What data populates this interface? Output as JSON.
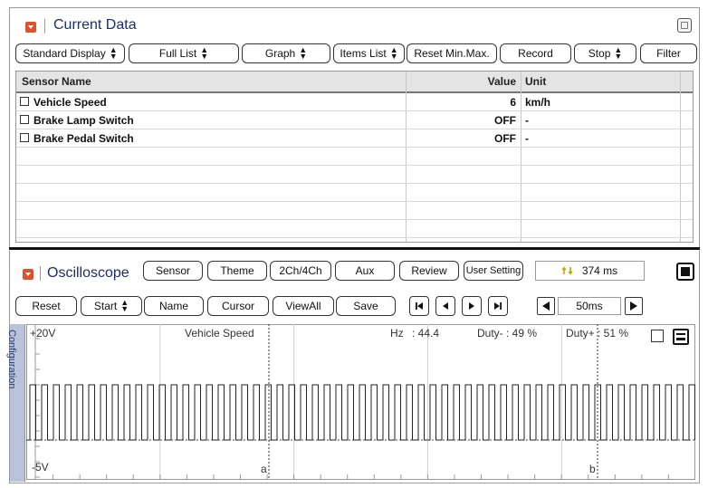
{
  "current_data": {
    "title": "Current Data",
    "toolbar": [
      {
        "label": "Standard Display",
        "dropdown": true
      },
      {
        "label": "Full List",
        "dropdown": true
      },
      {
        "label": "Graph",
        "dropdown": true
      },
      {
        "label": "Items List",
        "dropdown": true
      },
      {
        "label": "Reset Min.Max.",
        "dropdown": false
      },
      {
        "label": "Record",
        "dropdown": false
      },
      {
        "label": "Stop",
        "dropdown": true
      },
      {
        "label": "Filter",
        "dropdown": false
      }
    ],
    "table": {
      "headers": {
        "name": "Sensor Name",
        "value": "Value",
        "unit": "Unit"
      },
      "rows": [
        {
          "name": "Vehicle Speed",
          "value": "6",
          "unit": "km/h"
        },
        {
          "name": "Brake Lamp Switch",
          "value": "OFF",
          "unit": "-"
        },
        {
          "name": "Brake Pedal Switch",
          "value": "OFF",
          "unit": "-"
        }
      ]
    }
  },
  "oscilloscope": {
    "title": "Oscilloscope",
    "top_buttons": [
      "Sensor",
      "Theme",
      "2Ch/4Ch",
      "Aux",
      "Review",
      "User Setting"
    ],
    "time_readout": "374 ms",
    "second_row_buttons": [
      {
        "label": "Reset",
        "dropdown": false
      },
      {
        "label": "Start",
        "dropdown": true
      },
      {
        "label": "Name",
        "dropdown": false
      },
      {
        "label": "Cursor",
        "dropdown": false
      },
      {
        "label": "ViewAll",
        "dropdown": false
      },
      {
        "label": "Save",
        "dropdown": false
      }
    ],
    "timebase": "50ms",
    "config_tab": "Configuration",
    "scope": {
      "y_max": "+20V",
      "y_min": "-5V",
      "channel": "Vehicle Speed",
      "hz_label": "Hz",
      "hz_value": ": 44.4",
      "duty_minus": "Duty- : 49 %",
      "duty_plus": "Duty+ : 51 %",
      "cursor_a": "a",
      "cursor_b": "b"
    }
  },
  "colors": {
    "title": "#1a2e6b",
    "accent": "#e0502c",
    "config_tab": "#b9c2d8"
  }
}
